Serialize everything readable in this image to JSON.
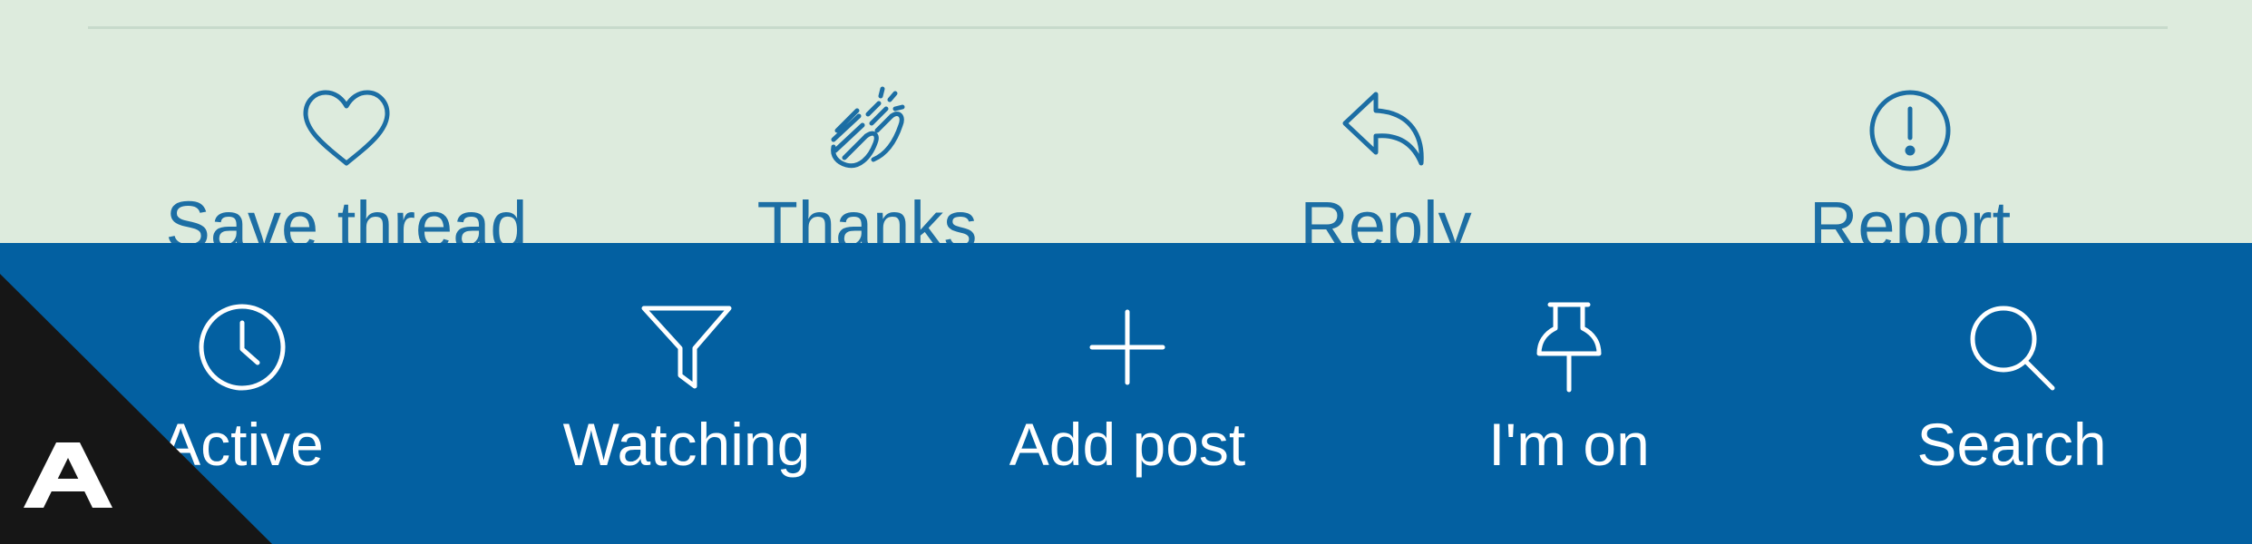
{
  "post_actions": {
    "items": [
      {
        "label": "Save thread",
        "icon": "heart-icon"
      },
      {
        "label": "Thanks",
        "icon": "clapping-hands-icon"
      },
      {
        "label": "Reply",
        "icon": "reply-arrow-icon"
      },
      {
        "label": "Report",
        "icon": "exclamation-circle-icon"
      }
    ]
  },
  "bottom_nav": {
    "items": [
      {
        "label": "Active",
        "icon": "clock-icon"
      },
      {
        "label": "Watching",
        "icon": "filter-funnel-icon"
      },
      {
        "label": "Add post",
        "icon": "plus-icon"
      },
      {
        "label": "I'm on",
        "icon": "pushpin-icon"
      },
      {
        "label": "Search",
        "icon": "search-icon"
      }
    ]
  },
  "brand": {
    "logo_letter": "A"
  },
  "colors": {
    "background": "#ddebdd",
    "action_text": "#1c6ea4",
    "nav_background": "#0360a1",
    "nav_text": "#ffffff",
    "badge": "#161616"
  }
}
